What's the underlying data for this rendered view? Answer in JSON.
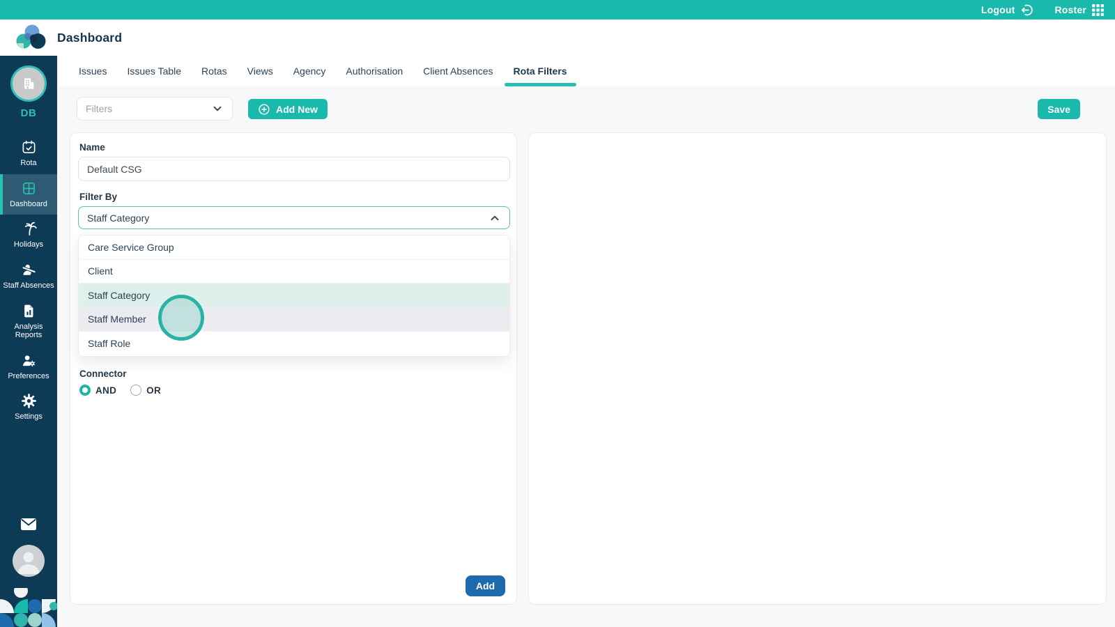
{
  "topbar": {
    "logout_label": "Logout",
    "roster_label": "Roster"
  },
  "header": {
    "title": "Dashboard"
  },
  "sidebar": {
    "user_initials": "DB",
    "items": [
      {
        "label": "Rota",
        "icon": "calendar-check-icon",
        "active": false
      },
      {
        "label": "Dashboard",
        "icon": "dashboard-grid-icon",
        "active": true
      },
      {
        "label": "Holidays",
        "icon": "palm-tree-icon",
        "active": false
      },
      {
        "label": "Staff Absences",
        "icon": "person-absent-icon",
        "active": false
      },
      {
        "label": "Analysis Reports",
        "icon": "report-chart-icon",
        "active": false
      },
      {
        "label": "Preferences",
        "icon": "person-gear-icon",
        "active": false
      },
      {
        "label": "Settings",
        "icon": "gear-icon",
        "active": false
      }
    ]
  },
  "tabs": [
    {
      "label": "Issues",
      "active": false
    },
    {
      "label": "Issues Table",
      "active": false
    },
    {
      "label": "Rotas",
      "active": false
    },
    {
      "label": "Views",
      "active": false
    },
    {
      "label": "Agency",
      "active": false
    },
    {
      "label": "Authorisation",
      "active": false
    },
    {
      "label": "Client Absences",
      "active": false
    },
    {
      "label": "Rota Filters",
      "active": true
    }
  ],
  "toolbar": {
    "filters_placeholder": "Filters",
    "add_new_label": "Add New",
    "save_label": "Save"
  },
  "form": {
    "name_label": "Name",
    "name_value": "Default CSG",
    "filter_by_label": "Filter By",
    "filter_by_value": "Staff Category",
    "dropdown_options": [
      {
        "label": "Care Service Group",
        "state": "normal"
      },
      {
        "label": "Client",
        "state": "normal"
      },
      {
        "label": "Staff Category",
        "state": "selected"
      },
      {
        "label": "Staff Member",
        "state": "hover"
      },
      {
        "label": "Staff Role",
        "state": "normal"
      }
    ],
    "connector_label": "Connector",
    "connector_options": [
      {
        "label": "AND",
        "checked": true
      },
      {
        "label": "OR",
        "checked": false
      }
    ],
    "add_label": "Add"
  },
  "colors": {
    "teal": "#19b9ac",
    "teal_bright": "#27c1b2",
    "sidebar_navy": "#0d3a55",
    "active_item_bg": "#2e5a74",
    "accent_blue": "#1d6bad",
    "selected_row": "#def0ec",
    "hover_row": "#ebecf0",
    "title_navy": "#17344e"
  }
}
